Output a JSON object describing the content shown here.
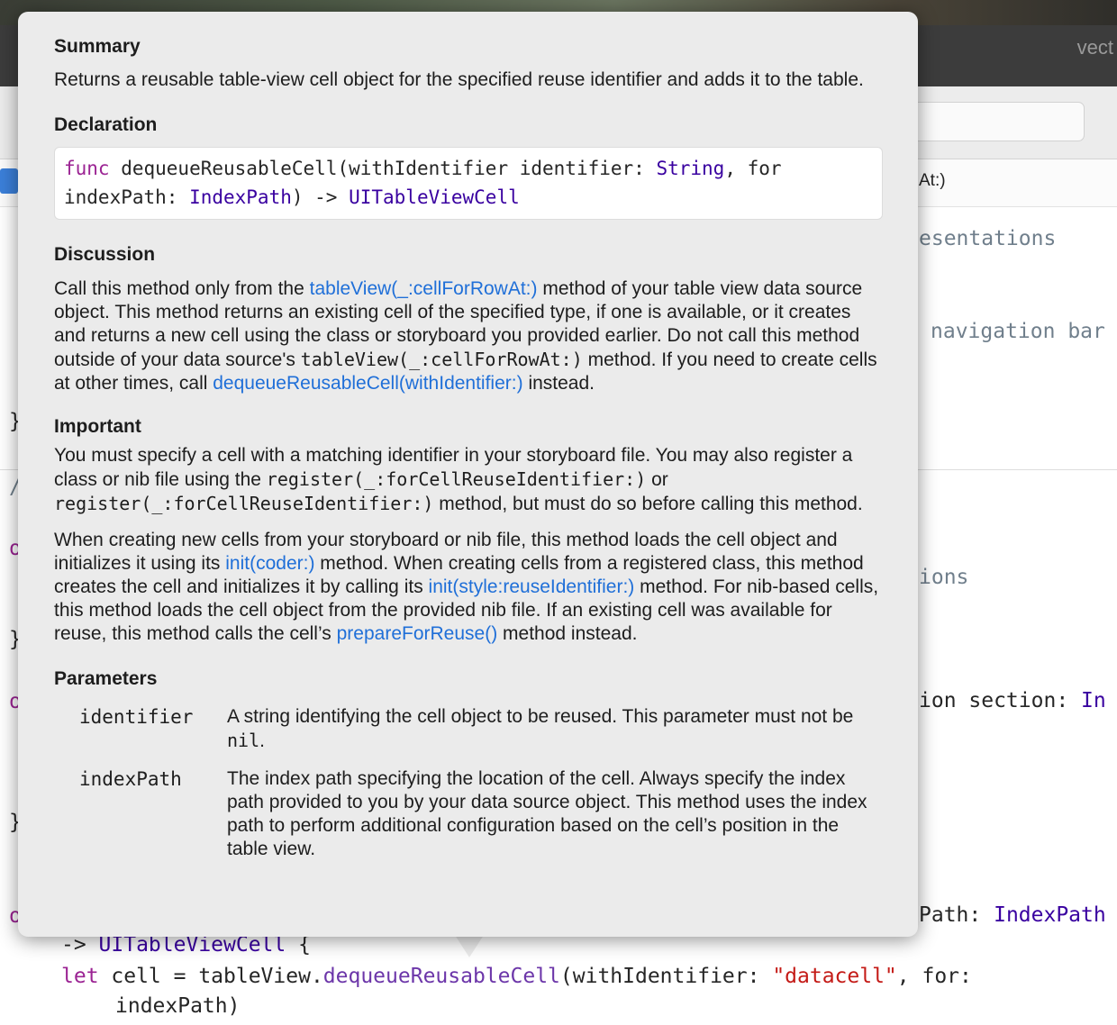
{
  "window": {
    "title_fragment": "vect"
  },
  "jumpbar": {
    "label_fragment": "At:)"
  },
  "background_code": {
    "line_presentations": "esentations",
    "line_navbar": "navigation bar",
    "brace1": "}",
    "slash": "/",
    "o1": "o",
    "line_ions": "ions",
    "brace2": "}",
    "o2": "o",
    "line_section_prefix": "ion section: ",
    "line_section_type": "In",
    "brace3": "}",
    "o3": "o",
    "line_path_prefix": "Path: ",
    "line_path_type": "IndexPath",
    "line_return_arrow": "-> ",
    "line_return_type": "UITableViewCell",
    "line_return_brace": " {",
    "let_kw": "let",
    "let_rest": " cell = tableView.",
    "let_method": "dequeueReusableCell",
    "let_args": "(withIdentifier: ",
    "let_string": "\"datacell\"",
    "let_for": ", for:",
    "let_cont": "indexPath)"
  },
  "quick_help": {
    "summary_heading": "Summary",
    "summary_text": "Returns a reusable table-view cell object for the specified reuse identifier and adds it to the table.",
    "declaration_heading": "Declaration",
    "declaration": {
      "keyword": "func",
      "name": " dequeueReusableCell(withIdentifier identifier: ",
      "type1": "String",
      "mid": ", for indexPath: ",
      "type2": "IndexPath",
      "arrow": ") -> ",
      "return_type": "UITableViewCell"
    },
    "discussion_heading": "Discussion",
    "discussion": {
      "t1": "Call this method only from the ",
      "link1": "tableView(_:cellForRowAt:)",
      "t2": " method of your table view data source object. This method returns an existing cell of the specified type, if one is available, or it creates and returns a new cell using the class or storyboard you provided earlier. Do not call this method outside of your data source's ",
      "code1": "tableView(_:cellForRowAt:)",
      "t3": " method. If you need to create cells at other times, call ",
      "link2": "dequeueReusableCell(withIdentifier:)",
      "t4": " instead."
    },
    "important_heading": "Important",
    "important": {
      "t1": "You must specify a cell with a matching identifier in your storyboard file. You may also register a class or nib file using the ",
      "code1": "register(_:forCellReuseIdentifier:)",
      "t2": " or ",
      "code2": "register(_:forCellReuseIdentifier:)",
      "t3": " method, but must do so before calling this method."
    },
    "creating": {
      "t1": "When creating new cells from your storyboard or nib file, this method loads the cell object and initializes it using its ",
      "link1": "init(coder:)",
      "t2": " method. When creating cells from a registered class, this method creates the cell and initializes it by calling its ",
      "link2": "init(style:reuseIdentifier:)",
      "t3": " method. For nib-based cells, this method loads the cell object from the provided nib file. If an existing cell was available for reuse, this method calls the cell’s ",
      "link3": "prepareForReuse()",
      "t4": " method instead."
    },
    "parameters_heading": "Parameters",
    "parameters": [
      {
        "name": "identifier",
        "desc_t1": "A string identifying the cell object to be reused. This parameter must not be ",
        "desc_code": "nil",
        "desc_t2": "."
      },
      {
        "name": "indexPath",
        "desc_t1": "The index path specifying the location of the cell. Always specify the index path provided to you by your data source object. This method uses the index path to perform additional configuration based on the cell’s position in the table view."
      }
    ]
  }
}
